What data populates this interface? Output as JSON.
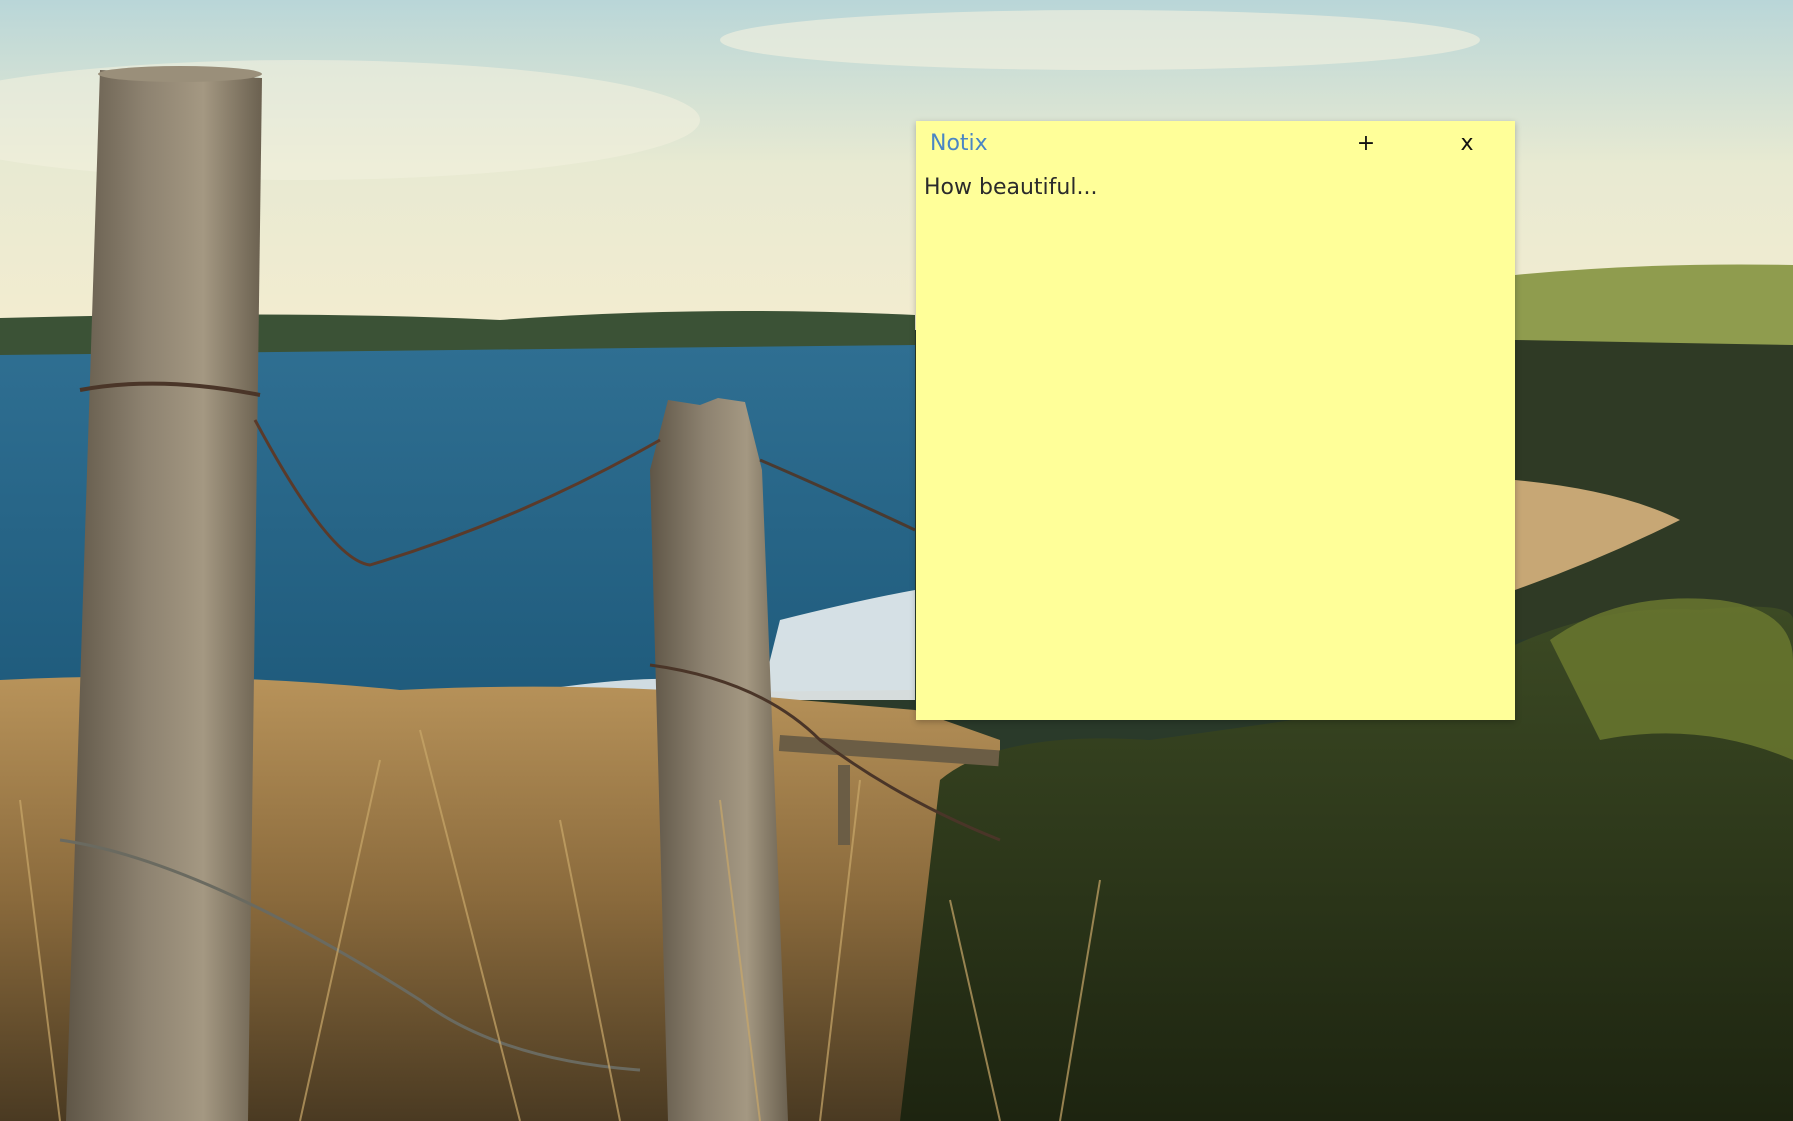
{
  "note": {
    "title": "Notix",
    "add_label": "+",
    "close_label": "x",
    "content": "How beautiful..."
  },
  "colors": {
    "note_background": "#ffff99",
    "title_color": "#4a86c4",
    "text_color": "#2b2b2b"
  },
  "icons": {
    "add": "plus-icon",
    "close": "close-icon"
  }
}
